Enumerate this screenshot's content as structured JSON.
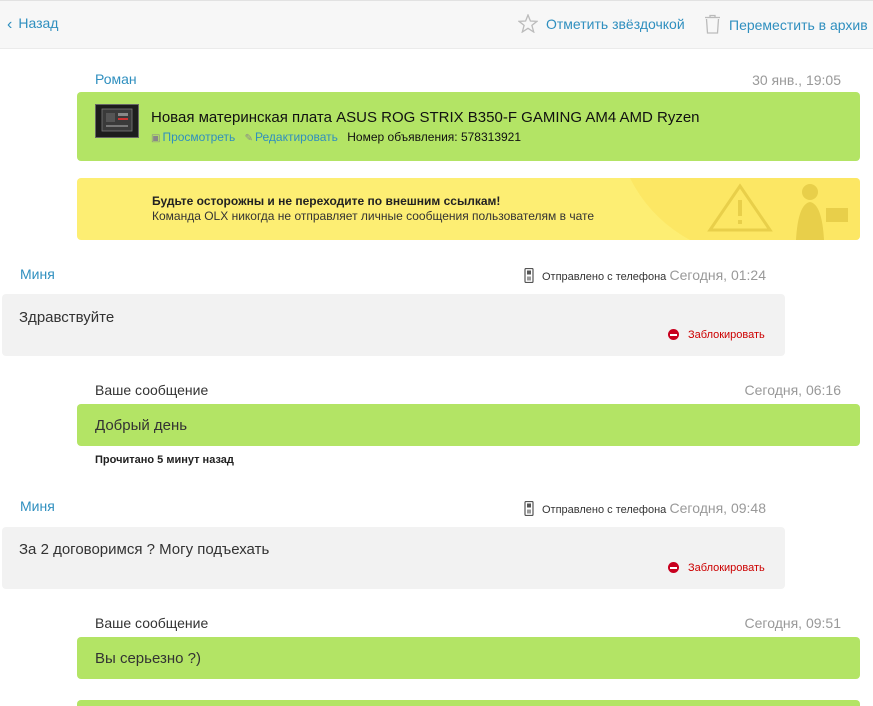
{
  "header": {
    "back_label": "Назад",
    "star_label": "Отметить звёздочкой",
    "archive_label": "Переместить в архив"
  },
  "ad": {
    "sender": "Роман",
    "time": "30 янв., 19:05",
    "title": "Новая материнская плата ASUS ROG STRIX B350-F GAMING AM4 AMD Ryzen",
    "view_label": "Просмотреть",
    "edit_label": "Редактировать",
    "ad_number_label": "Номер объявления: 578313921"
  },
  "warning": {
    "title": "Будьте осторожны и не переходите по внешним ссылкам!",
    "text": "Команда OLX никогда не отправляет личные сообщения пользователям в чате"
  },
  "messages": [
    {
      "sender": "Миня",
      "device": "Отправлено с телефона",
      "time": "Сегодня, 01:24",
      "text": "Здравствуйте",
      "block_label": "Заблокировать"
    },
    {
      "label": "Ваше сообщение",
      "time": "Сегодня, 06:16",
      "text": "Добрый день",
      "read_status": "Прочитано 5 минут назад"
    },
    {
      "sender": "Миня",
      "device": "Отправлено с телефона",
      "time": "Сегодня, 09:48",
      "text": "За 2 договоримся ? Могу подъехать",
      "block_label": "Заблокировать"
    },
    {
      "label": "Ваше сообщение",
      "time": "Сегодня, 09:51",
      "text": "Вы серьезно ?)"
    }
  ],
  "colors": {
    "link": "#2f8fbf",
    "own_bubble": "#b3e465",
    "incoming_bubble": "#f2f2f2",
    "warning_bg": "#fdee73",
    "block_red": "#c8001f"
  }
}
